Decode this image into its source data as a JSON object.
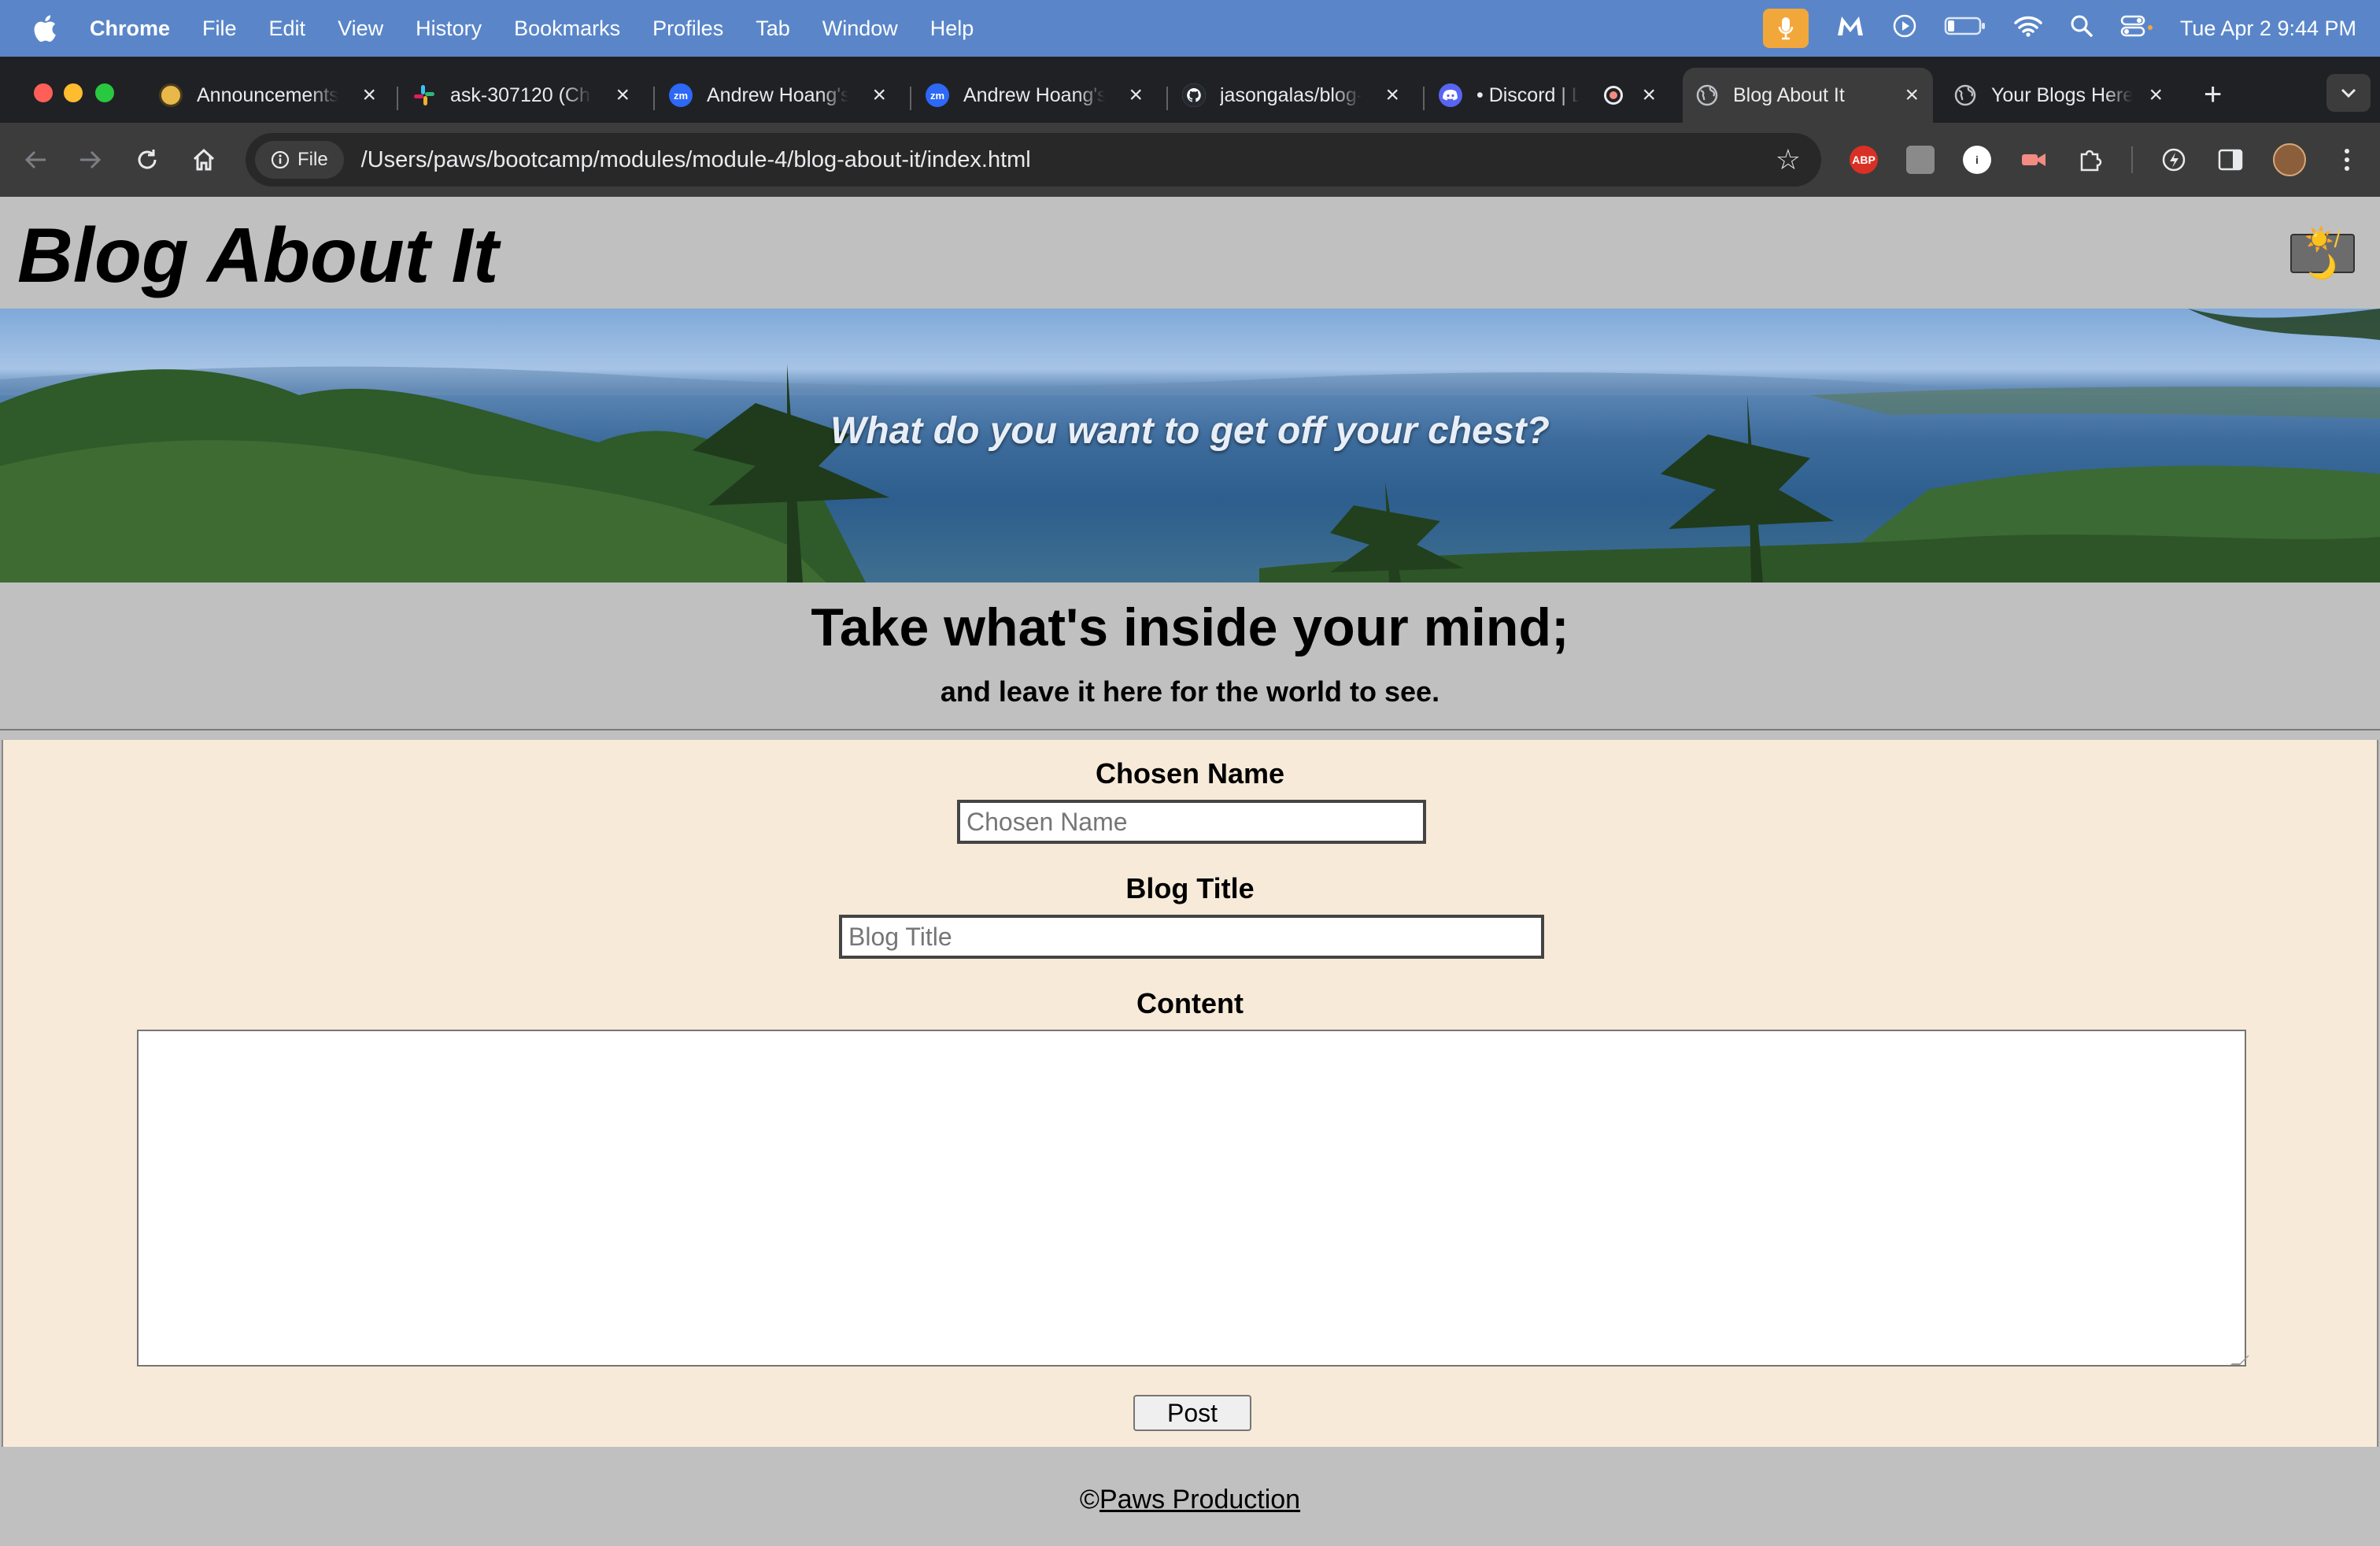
{
  "menubar": {
    "app": "Chrome",
    "items": [
      "File",
      "Edit",
      "View",
      "History",
      "Bookmarks",
      "Profiles",
      "Tab",
      "Window",
      "Help"
    ],
    "clock": "Tue Apr 2  9:44 PM"
  },
  "tabs": [
    {
      "label": "Announcements",
      "icon": "announcements-favicon"
    },
    {
      "label": "ask-307120 (Ch",
      "icon": "slack-icon"
    },
    {
      "label": "Andrew Hoang's",
      "icon": "zoom-icon"
    },
    {
      "label": "Andrew Hoang's",
      "icon": "zoom-icon"
    },
    {
      "label": "jasongalas/blog-",
      "icon": "github-icon"
    },
    {
      "label": "• Discord | L",
      "icon": "discord-icon"
    },
    {
      "label": "Blog About It",
      "icon": "globe-icon",
      "active": true
    },
    {
      "label": "Your Blogs Here",
      "icon": "globe-icon"
    }
  ],
  "toolbar": {
    "chip": "File",
    "url": "/Users/paws/bootcamp/modules/module-4/blog-about-it/index.html",
    "abp": "ABP"
  },
  "page": {
    "title": "Blog About It",
    "toggle": "☀️/🌙",
    "tagline": "What do you want to get off your chest?",
    "heading": "Take what's inside your mind;",
    "subheading": "and leave it here for the world to see.",
    "form": {
      "name_label": "Chosen Name",
      "name_placeholder": "Chosen Name",
      "title_label": "Blog Title",
      "title_placeholder": "Blog Title",
      "content_label": "Content",
      "submit": "Post"
    },
    "footer": {
      "copyright": "©",
      "link": "Paws Production"
    }
  },
  "colors": {
    "menubar": "#5a86c9",
    "page_bg": "#c0c0c0",
    "form_bg": "#f7ead8",
    "tab_strip": "#202124",
    "toolbar": "#3c3c3c"
  }
}
